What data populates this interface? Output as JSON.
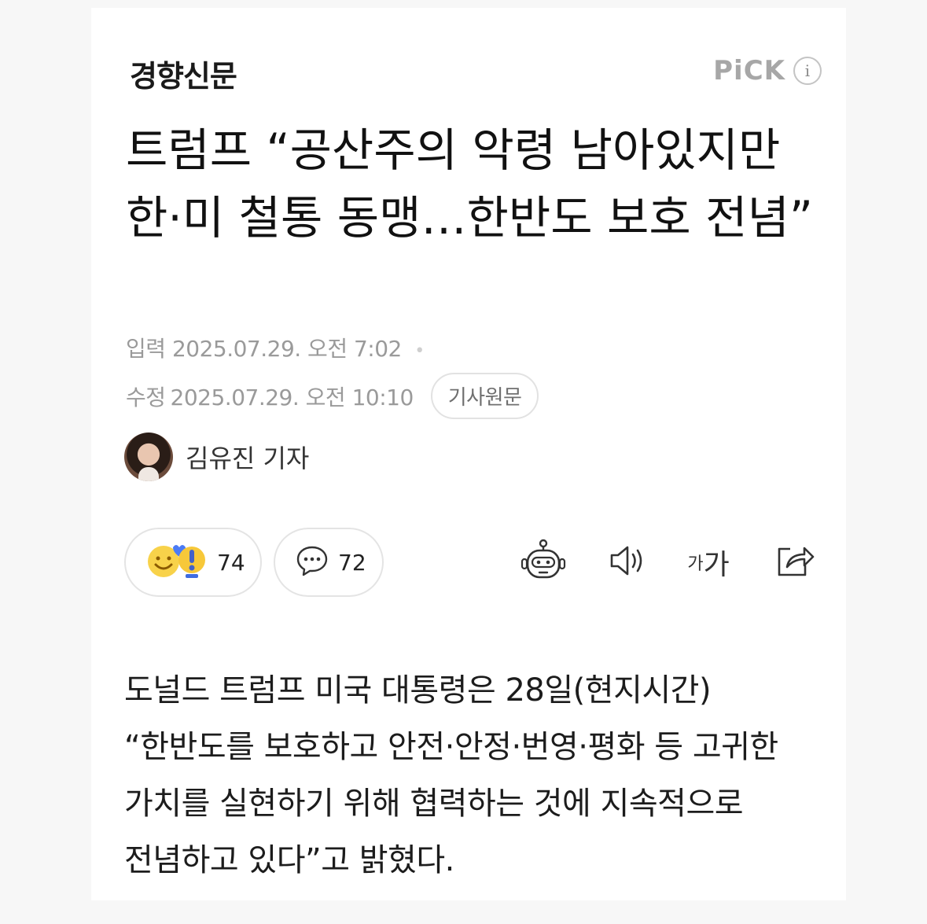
{
  "press": {
    "name": "경향신문",
    "pick_label": "PiCK",
    "info_icon": "info-icon"
  },
  "article": {
    "headline": "트럼프 “공산주의 악령 남아있지만 한·미 철통 동맹…한반도 보호 전념”",
    "input_label": "입력",
    "input_time": "2025.07.29. 오전 7:02",
    "edit_label": "수정",
    "edit_time": "2025.07.29. 오전 10:10",
    "original_button": "기사원문",
    "body": "도널드 트럼프 미국 대통령은 28일(현지시간) “한반도를 보호하고 안전·안정·번영·평화 등 고귀한 가치를 실현하기 위해 협력하는 것에 지속적으로 전념하고 있다”고 밝혔다."
  },
  "reporter": {
    "name": "김유진 기자"
  },
  "actions": {
    "reaction_count": "74",
    "comment_count": "72",
    "font_size_small": "가",
    "font_size_large": "가"
  },
  "colors": {
    "meta_gray": "#9a9a9a",
    "pick_gray": "#a7a7a7",
    "text_dark": "#111111"
  }
}
